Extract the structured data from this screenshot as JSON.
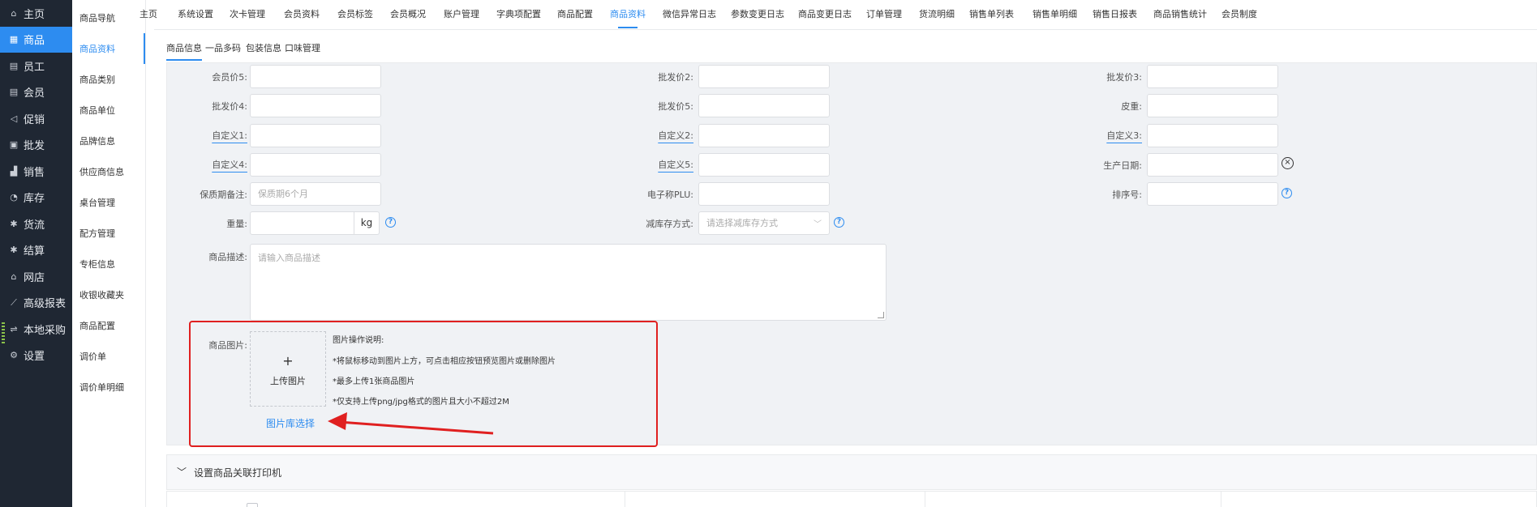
{
  "left_nav": {
    "items": [
      {
        "label": "主页",
        "icon": "home-icon",
        "glyph": "⌂"
      },
      {
        "label": "商品",
        "icon": "goods-icon",
        "glyph": "▦",
        "active": true
      },
      {
        "label": "员工",
        "icon": "staff-icon",
        "glyph": "▤"
      },
      {
        "label": "会员",
        "icon": "member-icon",
        "glyph": "▤"
      },
      {
        "label": "促销",
        "icon": "promotion-icon",
        "glyph": "◁"
      },
      {
        "label": "批发",
        "icon": "wholesale-icon",
        "glyph": "▣"
      },
      {
        "label": "销售",
        "icon": "sales-chart-icon",
        "glyph": "▟"
      },
      {
        "label": "库存",
        "icon": "inventory-icon",
        "glyph": "◔"
      },
      {
        "label": "货流",
        "icon": "flow-icon",
        "glyph": "✱"
      },
      {
        "label": "结算",
        "icon": "settlement-icon",
        "glyph": "✱"
      },
      {
        "label": "网店",
        "icon": "shop-icon",
        "glyph": "⌂"
      },
      {
        "label": "高级报表",
        "icon": "report-icon",
        "glyph": "⟋"
      },
      {
        "label": "本地采购",
        "icon": "purchase-icon",
        "glyph": "⇌"
      },
      {
        "label": "设置",
        "icon": "settings-gear-icon",
        "glyph": "⚙"
      }
    ]
  },
  "sub_nav": {
    "items": [
      {
        "label": "商品导航"
      },
      {
        "label": "商品资料",
        "active": true
      },
      {
        "label": "商品类别"
      },
      {
        "label": "商品单位"
      },
      {
        "label": "品牌信息"
      },
      {
        "label": "供应商信息"
      },
      {
        "label": "桌台管理"
      },
      {
        "label": "配方管理"
      },
      {
        "label": "专柜信息"
      },
      {
        "label": "收银收藏夹"
      },
      {
        "label": "商品配置"
      },
      {
        "label": "调价单"
      },
      {
        "label": "调价单明细"
      }
    ]
  },
  "top_tabs": [
    {
      "label": "主页"
    },
    {
      "label": "系统设置"
    },
    {
      "label": "次卡管理"
    },
    {
      "label": "会员资料"
    },
    {
      "label": "会员标签"
    },
    {
      "label": "会员概况"
    },
    {
      "label": "账户管理"
    },
    {
      "label": "字典项配置"
    },
    {
      "label": "商品配置"
    },
    {
      "label": "商品资料",
      "active": true
    },
    {
      "label": "微信异常日志"
    },
    {
      "label": "参数变更日志"
    },
    {
      "label": "商品变更日志"
    },
    {
      "label": "订单管理"
    },
    {
      "label": "货流明细"
    },
    {
      "label": "销售单列表"
    },
    {
      "label": "销售单明细"
    },
    {
      "label": "销售日报表"
    },
    {
      "label": "商品销售统计"
    },
    {
      "label": "会员制度"
    }
  ],
  "sub_tabs": [
    {
      "label": "商品信息",
      "active": true
    },
    {
      "label": "一品多码"
    },
    {
      "label": "包装信息"
    },
    {
      "label": "口味管理"
    }
  ],
  "form": {
    "member_price5": {
      "label": "会员价5:",
      "value": ""
    },
    "wholesale_price2": {
      "label": "批发价2:",
      "value": ""
    },
    "wholesale_price3": {
      "label": "批发价3:",
      "value": ""
    },
    "wholesale_price4": {
      "label": "批发价4:",
      "value": ""
    },
    "wholesale_price5": {
      "label": "批发价5:",
      "value": ""
    },
    "tare_weight": {
      "label": "皮重:",
      "value": ""
    },
    "custom1": {
      "label": "自定义1:",
      "value": ""
    },
    "custom2": {
      "label": "自定义2:",
      "value": ""
    },
    "custom3": {
      "label": "自定义3:",
      "value": ""
    },
    "custom4": {
      "label": "自定义4:",
      "value": ""
    },
    "custom5": {
      "label": "自定义5:",
      "value": ""
    },
    "production_date": {
      "label": "生产日期:",
      "value": ""
    },
    "shelf_life_note": {
      "label": "保质期备注:",
      "placeholder": "保质期6个月"
    },
    "scale_plu": {
      "label": "电子称PLU:",
      "value": ""
    },
    "sort_no": {
      "label": "排序号:",
      "value": ""
    },
    "weight": {
      "label": "重量:",
      "value": "",
      "unit": "kg"
    },
    "stock_reduce": {
      "label": "减库存方式:",
      "placeholder": "请选择减库存方式"
    },
    "description": {
      "label": "商品描述:",
      "placeholder": "请输入商品描述"
    },
    "image": {
      "label": "商品图片:",
      "upload_plus": "+",
      "upload_text": "上传图片",
      "notes_title": "图片操作说明:",
      "notes": [
        "*将鼠标移动到图片上方，可点击相应按钮预览图片或删除图片",
        "*最多上传1张商品图片",
        "*仅支持上传png/jpg格式的图片且大小不超过2M"
      ],
      "library_link": "图片库选择"
    }
  },
  "printer_section": {
    "title": "设置商品关联打印机"
  },
  "annotation_color": "#e02020",
  "accent_color": "#2d8cf0"
}
